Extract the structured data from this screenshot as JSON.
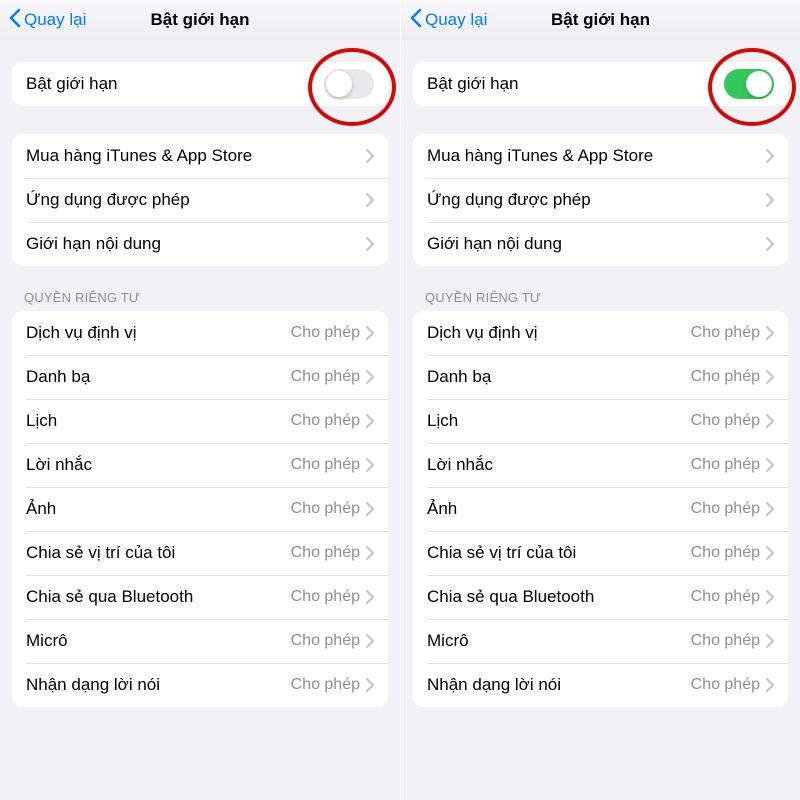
{
  "header": {
    "back_label": "Quay lại",
    "title": "Bật giới hạn"
  },
  "toggle_row": {
    "label": "Bật giới hạn"
  },
  "group2": {
    "items": [
      {
        "label": "Mua hàng iTunes & App Store"
      },
      {
        "label": "Ứng dụng được phép"
      },
      {
        "label": "Giới hạn nội dung"
      }
    ]
  },
  "privacy_header": "QUYỀN RIÊNG TƯ",
  "privacy": {
    "items": [
      {
        "label": "Dịch vụ định vị",
        "value": "Cho phép"
      },
      {
        "label": "Danh bạ",
        "value": "Cho phép"
      },
      {
        "label": "Lịch",
        "value": "Cho phép"
      },
      {
        "label": "Lời nhắc",
        "value": "Cho phép"
      },
      {
        "label": "Ảnh",
        "value": "Cho phép"
      },
      {
        "label": "Chia sẻ vị trí của tôi",
        "value": "Cho phép"
      },
      {
        "label": "Chia sẻ qua Bluetooth",
        "value": "Cho phép"
      },
      {
        "label": "Micrô",
        "value": "Cho phép"
      },
      {
        "label": "Nhận dạng lời nói",
        "value": "Cho phép"
      }
    ]
  },
  "panes": [
    {
      "toggle_on": false
    },
    {
      "toggle_on": true
    }
  ],
  "colors": {
    "tint": "#007aff",
    "toggle_on_green": "#34c759",
    "annotation_red": "#d20a0a"
  }
}
